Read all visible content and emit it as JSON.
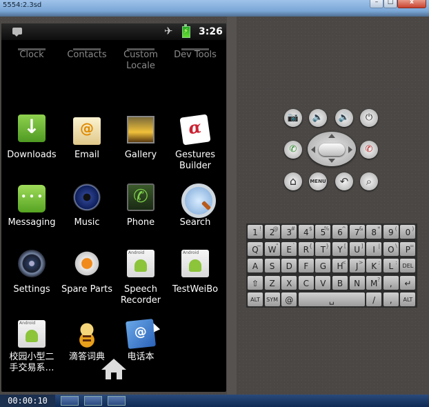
{
  "window": {
    "title": "5554:2.3sd",
    "close_glyph": "x"
  },
  "statusbar": {
    "time": "3:26",
    "airplane_glyph": "✈",
    "battery_glyph": "⚡"
  },
  "apps": {
    "top": [
      "Clock",
      "Contacts",
      "Custom Locale",
      "Dev Tools"
    ],
    "r1": [
      "Downloads",
      "Email",
      "Gallery",
      "Gestures Builder"
    ],
    "r2": [
      "Messaging",
      "Music",
      "Phone",
      "Search"
    ],
    "r3": [
      "Settings",
      "Spare Parts",
      "Speech Recorder",
      "TestWeiBo"
    ],
    "r4": [
      "校园小型二手交易系…",
      "滴答词典",
      "电话本"
    ]
  },
  "controls": {
    "camera": "📷",
    "vol_down": "🔉",
    "vol_up": "🔊",
    "power": "⏻",
    "call": "✆",
    "end_call": "✆",
    "home": "⌂",
    "menu": "MENU",
    "back": "↶",
    "search": "⌕"
  },
  "keyboard": {
    "row1": [
      "1",
      "2",
      "3",
      "4",
      "5",
      "6",
      "7",
      "8",
      "9",
      "0"
    ],
    "row1_sup": [
      "!",
      "@",
      "#",
      "$",
      "%",
      "^",
      "&",
      "*",
      "(",
      ")"
    ],
    "row2": [
      "Q",
      "W",
      "E",
      "R",
      "T",
      "Y",
      "U",
      "I",
      "O",
      "P"
    ],
    "row2_sup": [
      "~",
      "\"",
      "`",
      "{",
      "}",
      "[",
      "]",
      "|",
      "\\",
      "="
    ],
    "row3": [
      "A",
      "S",
      "D",
      "F",
      "G",
      "H",
      "J",
      "K",
      "L"
    ],
    "row3_sup": [
      "",
      "",
      "",
      "",
      "",
      "<",
      ">",
      ";",
      ":"
    ],
    "del": "DEL",
    "row4": [
      "Z",
      "X",
      "C",
      "V",
      "B",
      "N",
      "M"
    ],
    "row4_sup": [
      "",
      "",
      "",
      "",
      "",
      "",
      "?"
    ],
    "shift": "⇧",
    "enter": "↵",
    "alt": "ALT",
    "sym": "SYM",
    "at": "@",
    "space": "␣",
    "slash": "/",
    "comma": ","
  },
  "taskbar": {
    "timer": "00:00:10"
  }
}
